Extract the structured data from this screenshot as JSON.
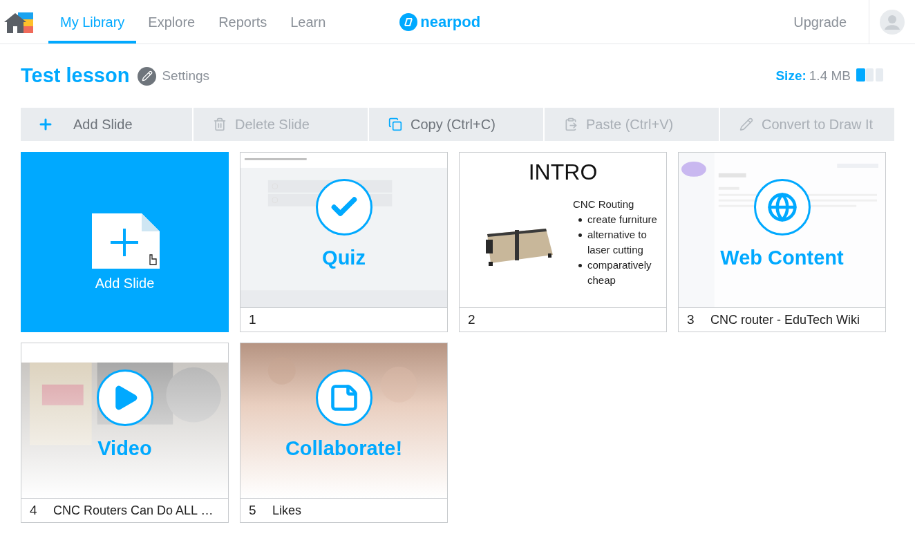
{
  "nav": {
    "tabs": [
      {
        "label": "My Library",
        "selected": true
      },
      {
        "label": "Explore",
        "selected": false
      },
      {
        "label": "Reports",
        "selected": false
      },
      {
        "label": "Learn",
        "selected": false
      }
    ],
    "logo": "nearpod",
    "upgrade": "Upgrade"
  },
  "lesson": {
    "title": "Test lesson",
    "settings": "Settings",
    "size_label": "Size:",
    "size_value": "1.4 MB",
    "level": 0.33
  },
  "toolbar": [
    {
      "kind": "add",
      "label": "Add Slide",
      "disabled": false
    },
    {
      "kind": "delete",
      "label": "Delete Slide",
      "disabled": true
    },
    {
      "kind": "copy",
      "label": "Copy (Ctrl+C)",
      "disabled": false
    },
    {
      "kind": "paste",
      "label": "Paste (Ctrl+V)",
      "disabled": true
    },
    {
      "kind": "draw",
      "label": "Convert to Draw It",
      "disabled": true
    }
  ],
  "add_tile": {
    "label": "Add Slide"
  },
  "slides": [
    {
      "kind": "quiz",
      "number": "1",
      "overlay": "Quiz"
    },
    {
      "kind": "slide",
      "number": "2",
      "heading": "INTRO",
      "subheading": "CNC Routing",
      "bullets": [
        "create furniture",
        "alternative to laser cutting",
        "comparatively cheap"
      ]
    },
    {
      "kind": "web",
      "number": "3",
      "overlay": "Web Content",
      "caption": "CNC router - EduTech Wiki"
    },
    {
      "kind": "video",
      "number": "4",
      "overlay": "Video",
      "caption": "CNC Routers Can Do ALL …"
    },
    {
      "kind": "collaborate",
      "number": "5",
      "overlay": "Collaborate!",
      "caption": "Likes"
    }
  ]
}
